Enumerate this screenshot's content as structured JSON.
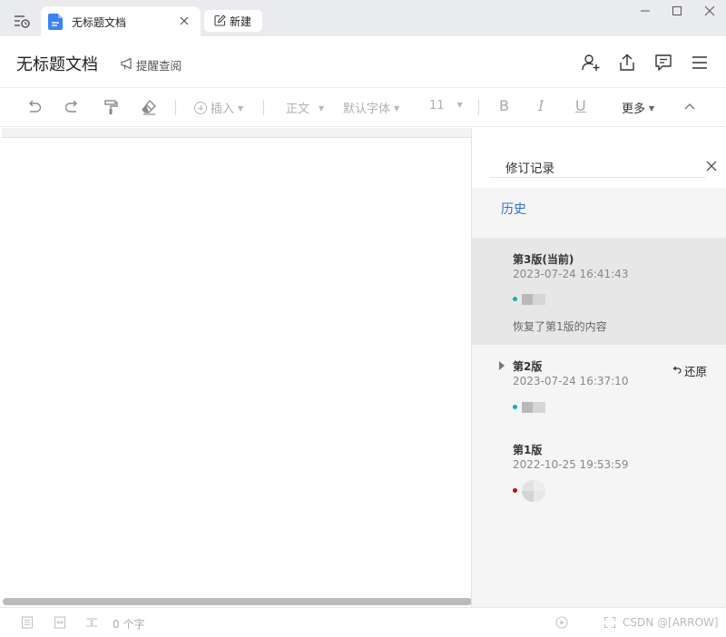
{
  "window": {
    "tab_title": "无标题文档",
    "new_tab_label": "新建"
  },
  "header": {
    "doc_title": "无标题文档",
    "remind_label": "提醒查阅",
    "icons": [
      "add-collaborator-icon",
      "share-export-icon",
      "comment-icon",
      "menu-icon"
    ]
  },
  "toolbar": {
    "insert_label": "插入",
    "style_label": "正文",
    "font_label": "默认字体",
    "font_size": "11",
    "bold": "B",
    "italic": "I",
    "underline": "U",
    "more_label": "更多"
  },
  "panel": {
    "title": "修订记录",
    "history_label": "历史",
    "versions": [
      {
        "name": "第3版(当前)",
        "time": "2023-07-24 16:41:43",
        "note": "恢复了第1版的内容",
        "dot_color": "#1aa6c9",
        "current": true
      },
      {
        "name": "第2版",
        "time": "2023-07-24 16:37:10",
        "restore_label": "还原",
        "dot_color": "#1aa6c9"
      },
      {
        "name": "第1版",
        "time": "2022-10-25 19:53:59",
        "dot_color": "#b3121b"
      }
    ]
  },
  "statusbar": {
    "word_count": "0 个字",
    "watermark": "CSDN @[ARROW]"
  },
  "colors": {
    "accent": "#2f6fd6",
    "titlebar_bg": "#eaebee",
    "panel_bg": "#f5f5f5",
    "current_version_bg": "#e7e7e7"
  }
}
